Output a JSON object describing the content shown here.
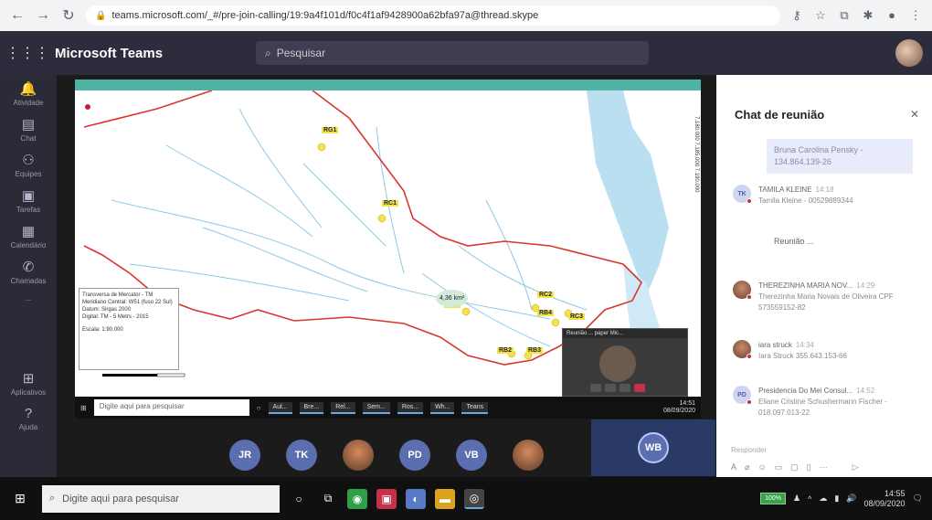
{
  "browser": {
    "url": "teams.microsoft.com/_#/pre-join-calling/19:9a4f101d/f0c4f1af9428900a62bfa97a@thread.skype"
  },
  "header": {
    "app_title": "Microsoft Teams",
    "search_placeholder": "Pesquisar"
  },
  "rail": {
    "items": [
      {
        "label": "Atividade",
        "icon": "bell-icon"
      },
      {
        "label": "Chat",
        "icon": "chat-icon"
      },
      {
        "label": "Equipes",
        "icon": "teams-icon"
      },
      {
        "label": "Tarefas",
        "icon": "tasks-icon"
      },
      {
        "label": "Calendário",
        "icon": "calendar-icon"
      },
      {
        "label": "Chamadas",
        "icon": "phone-icon"
      },
      {
        "label": "...",
        "icon": "more-icon"
      },
      {
        "label": "Aplicativos",
        "icon": "apps-icon"
      },
      {
        "label": "Ajuda",
        "icon": "help-icon"
      }
    ]
  },
  "map": {
    "area_label": "4,36 km²",
    "sites": [
      "RG1",
      "RC1",
      "RB1",
      "RC2",
      "RB4",
      "RC3",
      "RB2",
      "RB3"
    ],
    "legend_lines": [
      "Transversa de Mercator - TM",
      "Meridiano Central: W51 (fuso 22 Sul)",
      "Datum: Sirgas 2000",
      "Digital: TM - 5 Metrs - 2015",
      "Escala: 1:90.000"
    ],
    "coord_right": "7.180.000   7.185.000   7.190.000"
  },
  "inner_taskbar": {
    "search_placeholder": "Digite aqui para pesquisar",
    "apps": [
      "Aul...",
      "Bre...",
      "Rel...",
      "Sem...",
      "Ros...",
      "Wh...",
      "Teans"
    ],
    "time": "14:51",
    "date": "08/09/2020"
  },
  "float_video": {
    "title": "Reunião ... paper Mic..."
  },
  "participants": [
    {
      "initials": "JR",
      "photo": false
    },
    {
      "initials": "TK",
      "photo": false
    },
    {
      "initials": "",
      "photo": true
    },
    {
      "initials": "PD",
      "photo": false
    },
    {
      "initials": "VB",
      "photo": false
    },
    {
      "initials": "",
      "photo": true
    }
  ],
  "self": {
    "initials": "WB"
  },
  "chat": {
    "title": "Chat de reunião",
    "mine_top": "Bruna Carolina Pensky - 134.864.139-26",
    "messages": [
      {
        "name": "TAMILA KLEINE",
        "time": "14:18",
        "text": "Tamila Kleine - 00529889344",
        "initials": "TK",
        "photo": false
      },
      {
        "name": "",
        "time": "",
        "text": "Reunião ...",
        "initials": "",
        "photo": false
      },
      {
        "name": "THEREZINHA MARIA NOV...",
        "time": "14:29",
        "text": "Therezinha Maria Novais de Oliveira CPF 573559152-82",
        "initials": "",
        "photo": true
      },
      {
        "name": "iara struck",
        "time": "14:34",
        "text": "Iara Struck 355.643.153-66",
        "initials": "",
        "photo": true
      },
      {
        "name": "Presidencia Do Mei Consul...",
        "time": "14:52",
        "text": "Eliane Cristine Schushermann Fischer - 018.097.013-22",
        "initials": "PD",
        "photo": false
      }
    ],
    "compose_placeholder": "Responder"
  },
  "taskbar": {
    "search_placeholder": "Digite aqui para pesquisar",
    "battery": "100%",
    "time": "14:55",
    "date": "08/09/2020"
  }
}
